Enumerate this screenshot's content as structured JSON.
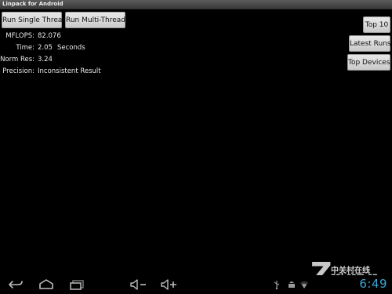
{
  "window": {
    "title": "Linpack for Android"
  },
  "toolbar": {
    "run_single": "Run Single Thread",
    "run_multi": "Run Multi-Thread"
  },
  "side_menu": {
    "top10": "Top 10",
    "latest_runs": "Latest Runs",
    "top_devices": "Top Devices"
  },
  "results": {
    "mflops_label": "MFLOPS:",
    "mflops_value": "82.076",
    "time_label": "Time:",
    "time_value": "2.05",
    "time_unit": "Seconds",
    "normres_label": "Norm Res:",
    "normres_value": "3.24",
    "precision_label": "Precision:",
    "precision_value": "Inconsistent Result"
  },
  "navbar": {
    "icons": [
      "back-icon",
      "home-icon",
      "recent-apps-icon",
      "volume-down-icon",
      "volume-up-icon"
    ],
    "status_icons": [
      "usb-icon",
      "android-debug-icon",
      "wifi-icon"
    ],
    "clock": "6:49",
    "clock_color": "#39a7d6"
  },
  "watermark": {
    "mark": "Z",
    "cn": "中关村在线",
    "en": "zol.com.cn"
  }
}
